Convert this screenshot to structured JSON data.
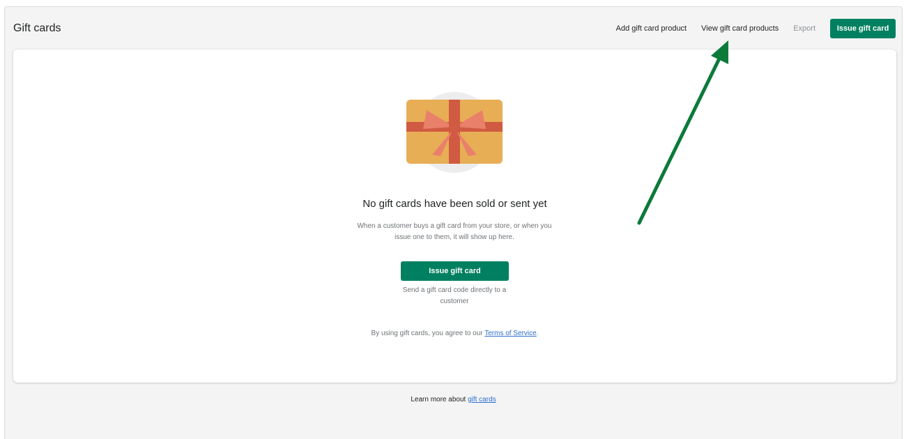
{
  "header": {
    "title": "Gift cards",
    "actions": {
      "add_product": "Add gift card product",
      "view_products": "View gift card products",
      "export": "Export",
      "issue": "Issue gift card"
    }
  },
  "empty_state": {
    "heading": "No gift cards have been sold or sent yet",
    "description": "When a customer buys a gift card from your store, or when you issue one to them, it will show up here.",
    "primary_action": "Issue gift card",
    "action_help": "Send a gift card code directly to a customer",
    "terms_prefix": "By using gift cards, you agree to our ",
    "terms_link": "Terms of Service",
    "terms_suffix": "."
  },
  "footer": {
    "prefix": "Learn more about ",
    "link": "gift cards"
  },
  "colors": {
    "primary": "#008060",
    "link": "#2c6ecb",
    "annotation_arrow": "#0b7a3b",
    "card_gold": "#e8ae55",
    "ribbon": "#d05a42",
    "bow": "#e9816a"
  },
  "icons": {
    "illustration": "gift-card-icon",
    "annotation": "arrow-annotation-icon"
  }
}
